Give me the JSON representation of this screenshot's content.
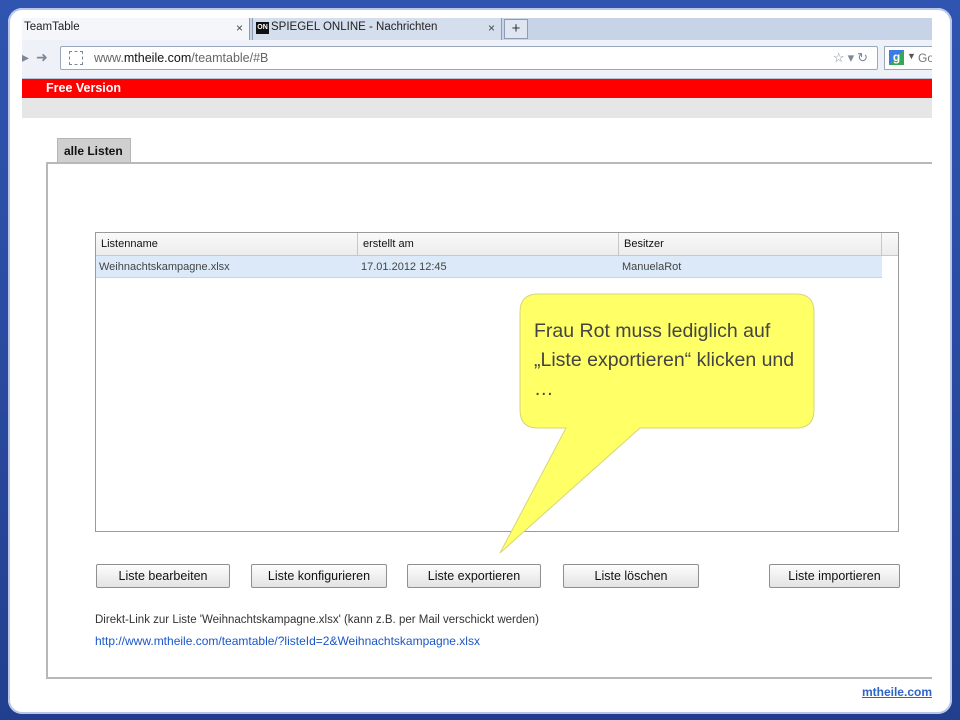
{
  "browser": {
    "tabs": [
      {
        "title": "TeamTable",
        "close": "×",
        "active": true
      },
      {
        "title": "SPIEGEL ONLINE - Nachrichten",
        "close": "×",
        "favicon": "ON",
        "active": false
      }
    ],
    "new_tab": "+",
    "url_host": "www.mthelle.com",
    "url_host_main": "mtheile.com",
    "url_prefix": "www.",
    "url_path": "/teamtable/#B",
    "search_text": "Go"
  },
  "page": {
    "free_version": "Free Version",
    "tab_label": "alle Listen",
    "grid": {
      "columns": [
        "Listenname",
        "erstellt am",
        "Besitzer"
      ],
      "rows": [
        [
          "Weihnachtskampagne.xlsx",
          "17.01.2012 12:45",
          "ManuelaRot"
        ]
      ]
    },
    "buttons": {
      "edit": "Liste bearbeiten",
      "configure": "Liste konfigurieren",
      "export": "Liste exportieren",
      "delete": "Liste löschen",
      "import": "Liste importieren"
    },
    "direct_link_label": "Direkt-Link zur Liste 'Weihnachtskampagne.xlsx' (kann z.B. per Mail verschickt werden)",
    "direct_link_url": "http://www.mtheile.com/teamtable/?listeId=2&Weihnachtskampagne.xlsx"
  },
  "callout": {
    "text": "Frau Rot muss lediglich auf „Liste exportieren“ klicken und …",
    "fill_color": "#ffff66"
  },
  "footer": {
    "link": "mtheile.com"
  },
  "colors": {
    "free_bar": "#ff0000",
    "slide_background": "#2a4aa0"
  }
}
